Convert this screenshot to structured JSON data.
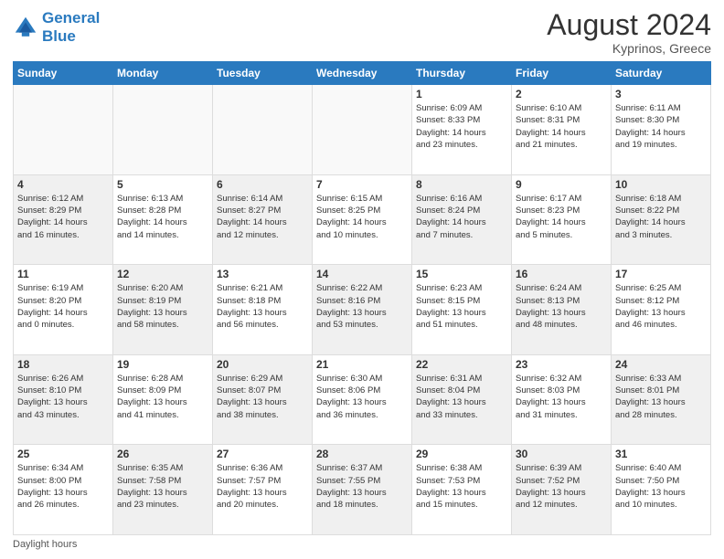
{
  "header": {
    "logo_line1": "General",
    "logo_line2": "Blue",
    "month_title": "August 2024",
    "location": "Kyprinos, Greece"
  },
  "days_of_week": [
    "Sunday",
    "Monday",
    "Tuesday",
    "Wednesday",
    "Thursday",
    "Friday",
    "Saturday"
  ],
  "weeks": [
    [
      {
        "day": "",
        "info": "",
        "empty": true
      },
      {
        "day": "",
        "info": "",
        "empty": true
      },
      {
        "day": "",
        "info": "",
        "empty": true
      },
      {
        "day": "",
        "info": "",
        "empty": true
      },
      {
        "day": "1",
        "info": "Sunrise: 6:09 AM\nSunset: 8:33 PM\nDaylight: 14 hours\nand 23 minutes."
      },
      {
        "day": "2",
        "info": "Sunrise: 6:10 AM\nSunset: 8:31 PM\nDaylight: 14 hours\nand 21 minutes."
      },
      {
        "day": "3",
        "info": "Sunrise: 6:11 AM\nSunset: 8:30 PM\nDaylight: 14 hours\nand 19 minutes."
      }
    ],
    [
      {
        "day": "4",
        "info": "Sunrise: 6:12 AM\nSunset: 8:29 PM\nDaylight: 14 hours\nand 16 minutes.",
        "shaded": true
      },
      {
        "day": "5",
        "info": "Sunrise: 6:13 AM\nSunset: 8:28 PM\nDaylight: 14 hours\nand 14 minutes."
      },
      {
        "day": "6",
        "info": "Sunrise: 6:14 AM\nSunset: 8:27 PM\nDaylight: 14 hours\nand 12 minutes.",
        "shaded": true
      },
      {
        "day": "7",
        "info": "Sunrise: 6:15 AM\nSunset: 8:25 PM\nDaylight: 14 hours\nand 10 minutes."
      },
      {
        "day": "8",
        "info": "Sunrise: 6:16 AM\nSunset: 8:24 PM\nDaylight: 14 hours\nand 7 minutes.",
        "shaded": true
      },
      {
        "day": "9",
        "info": "Sunrise: 6:17 AM\nSunset: 8:23 PM\nDaylight: 14 hours\nand 5 minutes."
      },
      {
        "day": "10",
        "info": "Sunrise: 6:18 AM\nSunset: 8:22 PM\nDaylight: 14 hours\nand 3 minutes.",
        "shaded": true
      }
    ],
    [
      {
        "day": "11",
        "info": "Sunrise: 6:19 AM\nSunset: 8:20 PM\nDaylight: 14 hours\nand 0 minutes."
      },
      {
        "day": "12",
        "info": "Sunrise: 6:20 AM\nSunset: 8:19 PM\nDaylight: 13 hours\nand 58 minutes.",
        "shaded": true
      },
      {
        "day": "13",
        "info": "Sunrise: 6:21 AM\nSunset: 8:18 PM\nDaylight: 13 hours\nand 56 minutes."
      },
      {
        "day": "14",
        "info": "Sunrise: 6:22 AM\nSunset: 8:16 PM\nDaylight: 13 hours\nand 53 minutes.",
        "shaded": true
      },
      {
        "day": "15",
        "info": "Sunrise: 6:23 AM\nSunset: 8:15 PM\nDaylight: 13 hours\nand 51 minutes."
      },
      {
        "day": "16",
        "info": "Sunrise: 6:24 AM\nSunset: 8:13 PM\nDaylight: 13 hours\nand 48 minutes.",
        "shaded": true
      },
      {
        "day": "17",
        "info": "Sunrise: 6:25 AM\nSunset: 8:12 PM\nDaylight: 13 hours\nand 46 minutes."
      }
    ],
    [
      {
        "day": "18",
        "info": "Sunrise: 6:26 AM\nSunset: 8:10 PM\nDaylight: 13 hours\nand 43 minutes.",
        "shaded": true
      },
      {
        "day": "19",
        "info": "Sunrise: 6:28 AM\nSunset: 8:09 PM\nDaylight: 13 hours\nand 41 minutes."
      },
      {
        "day": "20",
        "info": "Sunrise: 6:29 AM\nSunset: 8:07 PM\nDaylight: 13 hours\nand 38 minutes.",
        "shaded": true
      },
      {
        "day": "21",
        "info": "Sunrise: 6:30 AM\nSunset: 8:06 PM\nDaylight: 13 hours\nand 36 minutes."
      },
      {
        "day": "22",
        "info": "Sunrise: 6:31 AM\nSunset: 8:04 PM\nDaylight: 13 hours\nand 33 minutes.",
        "shaded": true
      },
      {
        "day": "23",
        "info": "Sunrise: 6:32 AM\nSunset: 8:03 PM\nDaylight: 13 hours\nand 31 minutes."
      },
      {
        "day": "24",
        "info": "Sunrise: 6:33 AM\nSunset: 8:01 PM\nDaylight: 13 hours\nand 28 minutes.",
        "shaded": true
      }
    ],
    [
      {
        "day": "25",
        "info": "Sunrise: 6:34 AM\nSunset: 8:00 PM\nDaylight: 13 hours\nand 26 minutes."
      },
      {
        "day": "26",
        "info": "Sunrise: 6:35 AM\nSunset: 7:58 PM\nDaylight: 13 hours\nand 23 minutes.",
        "shaded": true
      },
      {
        "day": "27",
        "info": "Sunrise: 6:36 AM\nSunset: 7:57 PM\nDaylight: 13 hours\nand 20 minutes."
      },
      {
        "day": "28",
        "info": "Sunrise: 6:37 AM\nSunset: 7:55 PM\nDaylight: 13 hours\nand 18 minutes.",
        "shaded": true
      },
      {
        "day": "29",
        "info": "Sunrise: 6:38 AM\nSunset: 7:53 PM\nDaylight: 13 hours\nand 15 minutes."
      },
      {
        "day": "30",
        "info": "Sunrise: 6:39 AM\nSunset: 7:52 PM\nDaylight: 13 hours\nand 12 minutes.",
        "shaded": true
      },
      {
        "day": "31",
        "info": "Sunrise: 6:40 AM\nSunset: 7:50 PM\nDaylight: 13 hours\nand 10 minutes."
      }
    ]
  ],
  "footer": {
    "note": "Daylight hours"
  }
}
